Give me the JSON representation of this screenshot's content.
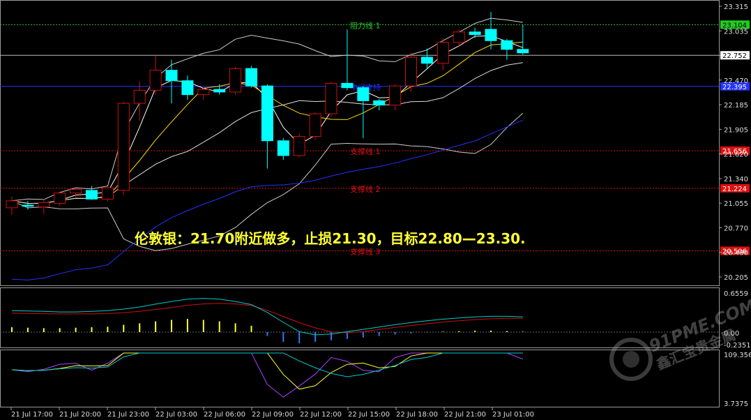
{
  "chart_data": {
    "type": "candlestick",
    "price_axis_ticks": [
      "23.315",
      "23.035",
      "22.752",
      "22.470",
      "22.185",
      "21.905",
      "21.620",
      "21.340",
      "21.055",
      "20.770",
      "20.490",
      "20.205"
    ],
    "macd_axis_ticks": [
      "0.6559",
      "0.00",
      "-0.2351"
    ],
    "osc_axis_ticks": [
      "109.3565",
      "3.7375"
    ],
    "time_labels": [
      "21 Jul 17:00",
      "21 Jul 20:00",
      "21 Jul 23:00",
      "22 Jul 03:00",
      "22 Jul 06:00",
      "22 Jul 09:00",
      "22 Jul 12:00",
      "22 Jul 15:00",
      "22 Jul 18:00",
      "22 Jul 21:00",
      "23 Jul 01:00"
    ],
    "current_price": "22.752",
    "levels": [
      {
        "name": "阻力线 1",
        "value": 23.104,
        "tag": "23.104",
        "color": "#22cc22"
      },
      {
        "name": "中间支持",
        "value": 22.395,
        "tag": "22.395",
        "color": "#2233ff"
      },
      {
        "name": "支撑线 1",
        "value": 21.656,
        "tag": "21.656",
        "color": "#dd1111"
      },
      {
        "name": "支撑线 2",
        "value": 21.224,
        "tag": "21.224",
        "color": "#dd1111"
      },
      {
        "name": "支撑线 3",
        "value": 20.506,
        "tag": "20.506",
        "color": "#dd1111"
      }
    ],
    "candles": [
      {
        "o": 21.0,
        "h": 21.13,
        "l": 20.92,
        "c": 21.08
      },
      {
        "o": 21.03,
        "h": 21.08,
        "l": 20.98,
        "c": 21.02
      },
      {
        "o": 21.01,
        "h": 21.1,
        "l": 20.93,
        "c": 21.06
      },
      {
        "o": 21.05,
        "h": 21.18,
        "l": 21.02,
        "c": 21.17
      },
      {
        "o": 21.17,
        "h": 21.22,
        "l": 21.12,
        "c": 21.21
      },
      {
        "o": 21.2,
        "h": 21.25,
        "l": 21.09,
        "c": 21.1
      },
      {
        "o": 21.1,
        "h": 21.24,
        "l": 21.07,
        "c": 21.23
      },
      {
        "o": 21.2,
        "h": 22.22,
        "l": 21.15,
        "c": 22.2
      },
      {
        "o": 22.2,
        "h": 22.45,
        "l": 22.0,
        "c": 22.35
      },
      {
        "o": 22.35,
        "h": 22.75,
        "l": 22.3,
        "c": 22.58
      },
      {
        "o": 22.58,
        "h": 22.7,
        "l": 22.2,
        "c": 22.46
      },
      {
        "o": 22.46,
        "h": 22.52,
        "l": 22.24,
        "c": 22.3
      },
      {
        "o": 22.3,
        "h": 22.38,
        "l": 22.24,
        "c": 22.36
      },
      {
        "o": 22.36,
        "h": 22.42,
        "l": 22.3,
        "c": 22.33
      },
      {
        "o": 22.33,
        "h": 22.62,
        "l": 22.3,
        "c": 22.6
      },
      {
        "o": 22.6,
        "h": 22.63,
        "l": 22.38,
        "c": 22.4
      },
      {
        "o": 22.4,
        "h": 22.42,
        "l": 21.45,
        "c": 21.77
      },
      {
        "o": 21.77,
        "h": 21.8,
        "l": 21.55,
        "c": 21.6
      },
      {
        "o": 21.6,
        "h": 21.85,
        "l": 21.58,
        "c": 21.82
      },
      {
        "o": 21.82,
        "h": 22.1,
        "l": 21.78,
        "c": 22.08
      },
      {
        "o": 22.08,
        "h": 22.45,
        "l": 22.05,
        "c": 22.43
      },
      {
        "o": 22.43,
        "h": 23.05,
        "l": 22.35,
        "c": 22.38
      },
      {
        "o": 22.38,
        "h": 22.4,
        "l": 21.8,
        "c": 22.23
      },
      {
        "o": 22.23,
        "h": 22.25,
        "l": 22.12,
        "c": 22.18
      },
      {
        "o": 22.18,
        "h": 22.42,
        "l": 22.12,
        "c": 22.4
      },
      {
        "o": 22.4,
        "h": 22.78,
        "l": 22.33,
        "c": 22.73
      },
      {
        "o": 22.73,
        "h": 22.83,
        "l": 22.6,
        "c": 22.66
      },
      {
        "o": 22.66,
        "h": 22.95,
        "l": 22.58,
        "c": 22.9
      },
      {
        "o": 22.9,
        "h": 23.05,
        "l": 22.85,
        "c": 23.02
      },
      {
        "o": 23.02,
        "h": 23.07,
        "l": 22.95,
        "c": 22.99
      },
      {
        "o": 23.05,
        "h": 23.25,
        "l": 22.82,
        "c": 22.92
      },
      {
        "o": 22.92,
        "h": 22.94,
        "l": 22.7,
        "c": 22.82
      },
      {
        "o": 22.82,
        "h": 23.1,
        "l": 22.76,
        "c": 22.78
      }
    ],
    "macd_hist": [
      0.1,
      0.09,
      0.08,
      0.08,
      0.09,
      0.1,
      0.11,
      0.15,
      0.18,
      0.22,
      0.25,
      0.27,
      0.25,
      0.22,
      0.18,
      0.13,
      -0.08,
      -0.2,
      -0.23,
      -0.2,
      -0.17,
      -0.14,
      -0.11,
      -0.08,
      -0.05,
      -0.03,
      -0.01,
      0.01,
      0.02,
      0.03,
      0.03,
      0.02,
      0.01
    ]
  },
  "annotation": "伦敦银：21.70附近做多，止损21.30，目标22.80—23.30.",
  "watermark": {
    "brand": "91PME.COM",
    "sub": "鑫汇宝贵金属"
  }
}
